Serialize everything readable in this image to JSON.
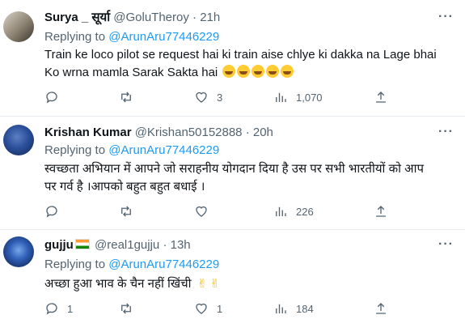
{
  "tweets": [
    {
      "name": "Surya _ सूर्या",
      "handle": "@GoluTheroy",
      "time": "21h",
      "replying_prefix": "Replying to ",
      "replying_to": "@ArunAru77446229",
      "body_line1": "Train ke loco pilot se request hai ki train aise chlye ki dakka na Lage bhai",
      "body_line2": "Ko wrna mamla Sarak Sakta hai",
      "emoji": "face-with-tears-of-joy x5",
      "replies": "",
      "retweets": "",
      "likes": "3",
      "views": "1,070"
    },
    {
      "name": "Krishan Kumar",
      "handle": "@Krishan50152888",
      "time": "20h",
      "replying_prefix": "Replying to ",
      "replying_to": "@ArunAru77446229",
      "body_line1": "स्वच्छता अभियान में आपने जो सराहनीय योगदान दिया है उस पर सभी भारतीयों को आप",
      "body_line2": "पर गर्व है ।आपको बहुत बहुत बधाई ।",
      "replies": "",
      "retweets": "",
      "likes": "",
      "views": "226"
    },
    {
      "name": "gujju",
      "handle": "@real1gujju",
      "time": "13h",
      "replying_prefix": "Replying to ",
      "replying_to": "@ArunAru77446229",
      "body_line1": "अच्छा हुआ भाव के चैन नहीं खिंची",
      "replies": "1",
      "retweets": "",
      "likes": "1",
      "views": "184"
    }
  ],
  "separator": "·",
  "more_glyph": "···",
  "colors": {
    "link": "#1d9bf0",
    "muted": "#536471",
    "text": "#0f1419"
  }
}
